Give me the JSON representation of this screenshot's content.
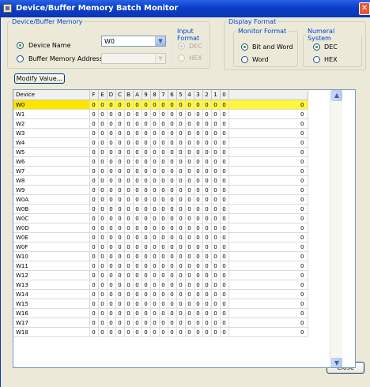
{
  "window": {
    "title": "Device/Buffer Memory Batch Monitor",
    "close_glyph": "✕"
  },
  "device_group": {
    "legend": "Device/Buffer Memory",
    "device_name_label": "Device Name",
    "device_name_value": "W0",
    "buffer_label": "Buffer Memory Address"
  },
  "input_format": {
    "legend": "Input Format",
    "dec": "DEC",
    "hex": "HEX"
  },
  "display_format": {
    "legend": "Display Format",
    "monitor_format": {
      "legend": "Monitor Format",
      "bit_and_word": "Bit and Word",
      "word": "Word"
    },
    "numeral_system": {
      "legend": "Numeral System",
      "dec": "DEC",
      "hex": "HEX"
    }
  },
  "modify_button": "Modify Value...",
  "close_button": "Close",
  "table": {
    "header": {
      "device": "Device",
      "bits": [
        "F",
        "E",
        "D",
        "C",
        "B",
        "A",
        "9",
        "8",
        "7",
        "6",
        "5",
        "4",
        "3",
        "2",
        "1",
        "0"
      ]
    },
    "selected_index": 0,
    "rows": [
      {
        "device": "W0",
        "bits": [
          "0",
          "0",
          "0",
          "0",
          "0",
          "0",
          "0",
          "0",
          "0",
          "0",
          "0",
          "0",
          "0",
          "0",
          "0",
          "0"
        ],
        "value": "0"
      },
      {
        "device": "W1",
        "bits": [
          "0",
          "0",
          "0",
          "0",
          "0",
          "0",
          "0",
          "0",
          "0",
          "0",
          "0",
          "0",
          "0",
          "0",
          "0",
          "0"
        ],
        "value": "0"
      },
      {
        "device": "W2",
        "bits": [
          "0",
          "0",
          "0",
          "0",
          "0",
          "0",
          "0",
          "0",
          "0",
          "0",
          "0",
          "0",
          "0",
          "0",
          "0",
          "0"
        ],
        "value": "0"
      },
      {
        "device": "W3",
        "bits": [
          "0",
          "0",
          "0",
          "0",
          "0",
          "0",
          "0",
          "0",
          "0",
          "0",
          "0",
          "0",
          "0",
          "0",
          "0",
          "0"
        ],
        "value": "0"
      },
      {
        "device": "W4",
        "bits": [
          "0",
          "0",
          "0",
          "0",
          "0",
          "0",
          "0",
          "0",
          "0",
          "0",
          "0",
          "0",
          "0",
          "0",
          "0",
          "0"
        ],
        "value": "0"
      },
      {
        "device": "W5",
        "bits": [
          "0",
          "0",
          "0",
          "0",
          "0",
          "0",
          "0",
          "0",
          "0",
          "0",
          "0",
          "0",
          "0",
          "0",
          "0",
          "0"
        ],
        "value": "0"
      },
      {
        "device": "W6",
        "bits": [
          "0",
          "0",
          "0",
          "0",
          "0",
          "0",
          "0",
          "0",
          "0",
          "0",
          "0",
          "0",
          "0",
          "0",
          "0",
          "0"
        ],
        "value": "0"
      },
      {
        "device": "W7",
        "bits": [
          "0",
          "0",
          "0",
          "0",
          "0",
          "0",
          "0",
          "0",
          "0",
          "0",
          "0",
          "0",
          "0",
          "0",
          "0",
          "0"
        ],
        "value": "0"
      },
      {
        "device": "W8",
        "bits": [
          "0",
          "0",
          "0",
          "0",
          "0",
          "0",
          "0",
          "0",
          "0",
          "0",
          "0",
          "0",
          "0",
          "0",
          "0",
          "0"
        ],
        "value": "0"
      },
      {
        "device": "W9",
        "bits": [
          "0",
          "0",
          "0",
          "0",
          "0",
          "0",
          "0",
          "0",
          "0",
          "0",
          "0",
          "0",
          "0",
          "0",
          "0",
          "0"
        ],
        "value": "0"
      },
      {
        "device": "W0A",
        "bits": [
          "0",
          "0",
          "0",
          "0",
          "0",
          "0",
          "0",
          "0",
          "0",
          "0",
          "0",
          "0",
          "0",
          "0",
          "0",
          "0"
        ],
        "value": "0"
      },
      {
        "device": "W0B",
        "bits": [
          "0",
          "0",
          "0",
          "0",
          "0",
          "0",
          "0",
          "0",
          "0",
          "0",
          "0",
          "0",
          "0",
          "0",
          "0",
          "0"
        ],
        "value": "0"
      },
      {
        "device": "W0C",
        "bits": [
          "0",
          "0",
          "0",
          "0",
          "0",
          "0",
          "0",
          "0",
          "0",
          "0",
          "0",
          "0",
          "0",
          "0",
          "0",
          "0"
        ],
        "value": "0"
      },
      {
        "device": "W0D",
        "bits": [
          "0",
          "0",
          "0",
          "0",
          "0",
          "0",
          "0",
          "0",
          "0",
          "0",
          "0",
          "0",
          "0",
          "0",
          "0",
          "0"
        ],
        "value": "0"
      },
      {
        "device": "W0E",
        "bits": [
          "0",
          "0",
          "0",
          "0",
          "0",
          "0",
          "0",
          "0",
          "0",
          "0",
          "0",
          "0",
          "0",
          "0",
          "0",
          "0"
        ],
        "value": "0"
      },
      {
        "device": "W0F",
        "bits": [
          "0",
          "0",
          "0",
          "0",
          "0",
          "0",
          "0",
          "0",
          "0",
          "0",
          "0",
          "0",
          "0",
          "0",
          "0",
          "0"
        ],
        "value": "0"
      },
      {
        "device": "W10",
        "bits": [
          "0",
          "0",
          "0",
          "0",
          "0",
          "0",
          "0",
          "0",
          "0",
          "0",
          "0",
          "0",
          "0",
          "0",
          "0",
          "0"
        ],
        "value": "0"
      },
      {
        "device": "W11",
        "bits": [
          "0",
          "0",
          "0",
          "0",
          "0",
          "0",
          "0",
          "0",
          "0",
          "0",
          "0",
          "0",
          "0",
          "0",
          "0",
          "0"
        ],
        "value": "0"
      },
      {
        "device": "W12",
        "bits": [
          "0",
          "0",
          "0",
          "0",
          "0",
          "0",
          "0",
          "0",
          "0",
          "0",
          "0",
          "0",
          "0",
          "0",
          "0",
          "0"
        ],
        "value": "0"
      },
      {
        "device": "W13",
        "bits": [
          "0",
          "0",
          "0",
          "0",
          "0",
          "0",
          "0",
          "0",
          "0",
          "0",
          "0",
          "0",
          "0",
          "0",
          "0",
          "0"
        ],
        "value": "0"
      },
      {
        "device": "W14",
        "bits": [
          "0",
          "0",
          "0",
          "0",
          "0",
          "0",
          "0",
          "0",
          "0",
          "0",
          "0",
          "0",
          "0",
          "0",
          "0",
          "0"
        ],
        "value": "0"
      },
      {
        "device": "W15",
        "bits": [
          "0",
          "0",
          "0",
          "0",
          "0",
          "0",
          "0",
          "0",
          "0",
          "0",
          "0",
          "0",
          "0",
          "0",
          "0",
          "0"
        ],
        "value": "0"
      },
      {
        "device": "W16",
        "bits": [
          "0",
          "0",
          "0",
          "0",
          "0",
          "0",
          "0",
          "0",
          "0",
          "0",
          "0",
          "0",
          "0",
          "0",
          "0",
          "0"
        ],
        "value": "0"
      },
      {
        "device": "W17",
        "bits": [
          "0",
          "0",
          "0",
          "0",
          "0",
          "0",
          "0",
          "0",
          "0",
          "0",
          "0",
          "0",
          "0",
          "0",
          "0",
          "0"
        ],
        "value": "0"
      },
      {
        "device": "W18",
        "bits": [
          "0",
          "0",
          "0",
          "0",
          "0",
          "0",
          "0",
          "0",
          "0",
          "0",
          "0",
          "0",
          "0",
          "0",
          "0",
          "0"
        ],
        "value": "0"
      }
    ]
  },
  "colors": {
    "title_bar": "#0a3ec8",
    "selected_row": "#fff73c",
    "dialog_face": "#ece9d8"
  },
  "icons": {
    "app": "window-app-icon",
    "close": "close-icon",
    "scroll_up": "scroll-up-arrow-icon",
    "scroll_down": "scroll-down-arrow-icon",
    "dropdown": "chevron-down-icon"
  }
}
